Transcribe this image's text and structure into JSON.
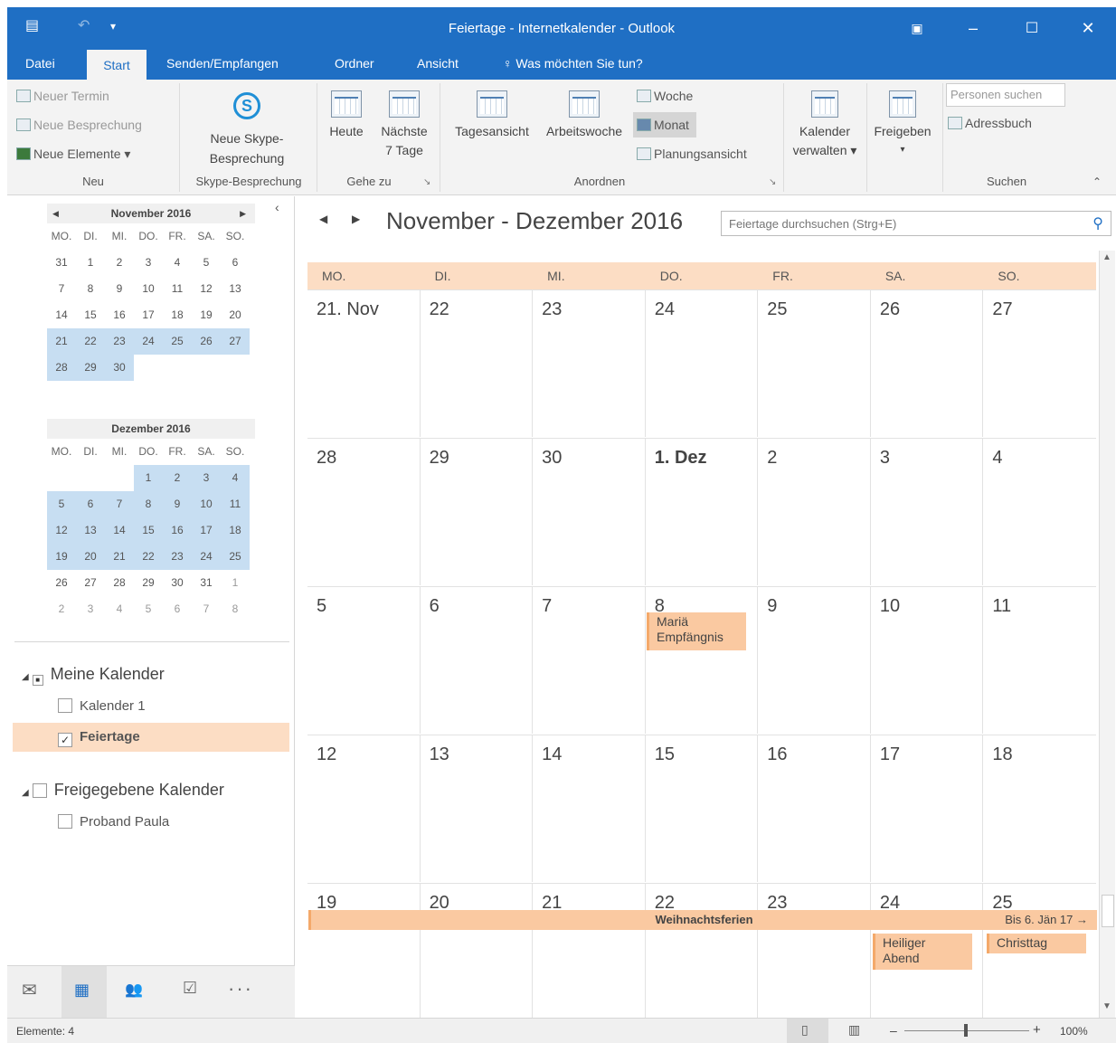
{
  "window": {
    "title": "Feiertage - Internetkalender - Outlook"
  },
  "tabs": [
    "Datei",
    "Start",
    "Senden/Empfangen",
    "Ordner",
    "Ansicht"
  ],
  "tellme": "Was möchten Sie tun?",
  "ribbon": {
    "neu": {
      "termin": "Neuer Termin",
      "besprechung": "Neue Besprechung",
      "elemente": "Neue Elemente",
      "group": "Neu"
    },
    "skype": {
      "label1": "Neue Skype-",
      "label2": "Besprechung",
      "group": "Skype-Besprechung"
    },
    "gehezu": {
      "heute": "Heute",
      "naechste1": "Nächste",
      "naechste2": "7 Tage",
      "group": "Gehe zu"
    },
    "anordnen": {
      "tages": "Tagesansicht",
      "arbeits": "Arbeitswoche",
      "woche": "Woche",
      "monat": "Monat",
      "planung": "Planungsansicht",
      "group": "Anordnen"
    },
    "kalender1": "Kalender",
    "kalender2": "verwalten",
    "freigeben": "Freigeben",
    "suchen": {
      "personen": "Personen suchen",
      "adressbuch": "Adressbuch",
      "group": "Suchen"
    }
  },
  "mini_nov": {
    "title": "November 2016",
    "dow": [
      "MO.",
      "DI.",
      "MI.",
      "DO.",
      "FR.",
      "SA.",
      "SO."
    ],
    "rows": [
      [
        "31",
        "1",
        "2",
        "3",
        "4",
        "5",
        "6"
      ],
      [
        "7",
        "8",
        "9",
        "10",
        "11",
        "12",
        "13"
      ],
      [
        "14",
        "15",
        "16",
        "17",
        "18",
        "19",
        "20"
      ],
      [
        "21",
        "22",
        "23",
        "24",
        "25",
        "26",
        "27"
      ],
      [
        "28",
        "29",
        "30"
      ]
    ]
  },
  "mini_dec": {
    "title": "Dezember 2016",
    "dow": [
      "MO.",
      "DI.",
      "MI.",
      "DO.",
      "FR.",
      "SA.",
      "SO."
    ],
    "rows": [
      [
        "",
        "",
        "",
        "1",
        "2",
        "3",
        "4"
      ],
      [
        "5",
        "6",
        "7",
        "8",
        "9",
        "10",
        "11"
      ],
      [
        "12",
        "13",
        "14",
        "15",
        "16",
        "17",
        "18"
      ],
      [
        "19",
        "20",
        "21",
        "22",
        "23",
        "24",
        "25"
      ],
      [
        "26",
        "27",
        "28",
        "29",
        "30",
        "31",
        "1"
      ],
      [
        "2",
        "3",
        "4",
        "5",
        "6",
        "7",
        "8"
      ]
    ]
  },
  "nav": {
    "meine": "Meine Kalender",
    "kalender1": "Kalender 1",
    "feiertage": "Feiertage",
    "freigegeben": "Freigegebene Kalender",
    "proband": "Proband Paula"
  },
  "calendar": {
    "title": "November - Dezember 2016",
    "search_placeholder": "Feiertage durchsuchen (Strg+E)",
    "weekdays": [
      "MO.",
      "DI.",
      "MI.",
      "DO.",
      "FR.",
      "SA.",
      "SO."
    ],
    "weeks": [
      [
        "21. Nov",
        "22",
        "23",
        "24",
        "25",
        "26",
        "27"
      ],
      [
        "28",
        "29",
        "30",
        "1. Dez",
        "2",
        "3",
        "4"
      ],
      [
        "5",
        "6",
        "7",
        "8",
        "9",
        "10",
        "11"
      ],
      [
        "12",
        "13",
        "14",
        "15",
        "16",
        "17",
        "18"
      ],
      [
        "19",
        "20",
        "21",
        "22",
        "23",
        "24",
        "25"
      ]
    ],
    "events": {
      "mariae1": "Mariä",
      "mariae2": "Empfängnis",
      "ferien": "Weihnachtsferien",
      "bis": "Bis 6. Jän 17",
      "heilig1": "Heiliger",
      "heilig2": "Abend",
      "christtag": "Christtag"
    }
  },
  "status": {
    "elemente": "Elemente: 4",
    "zoom": "100%"
  }
}
